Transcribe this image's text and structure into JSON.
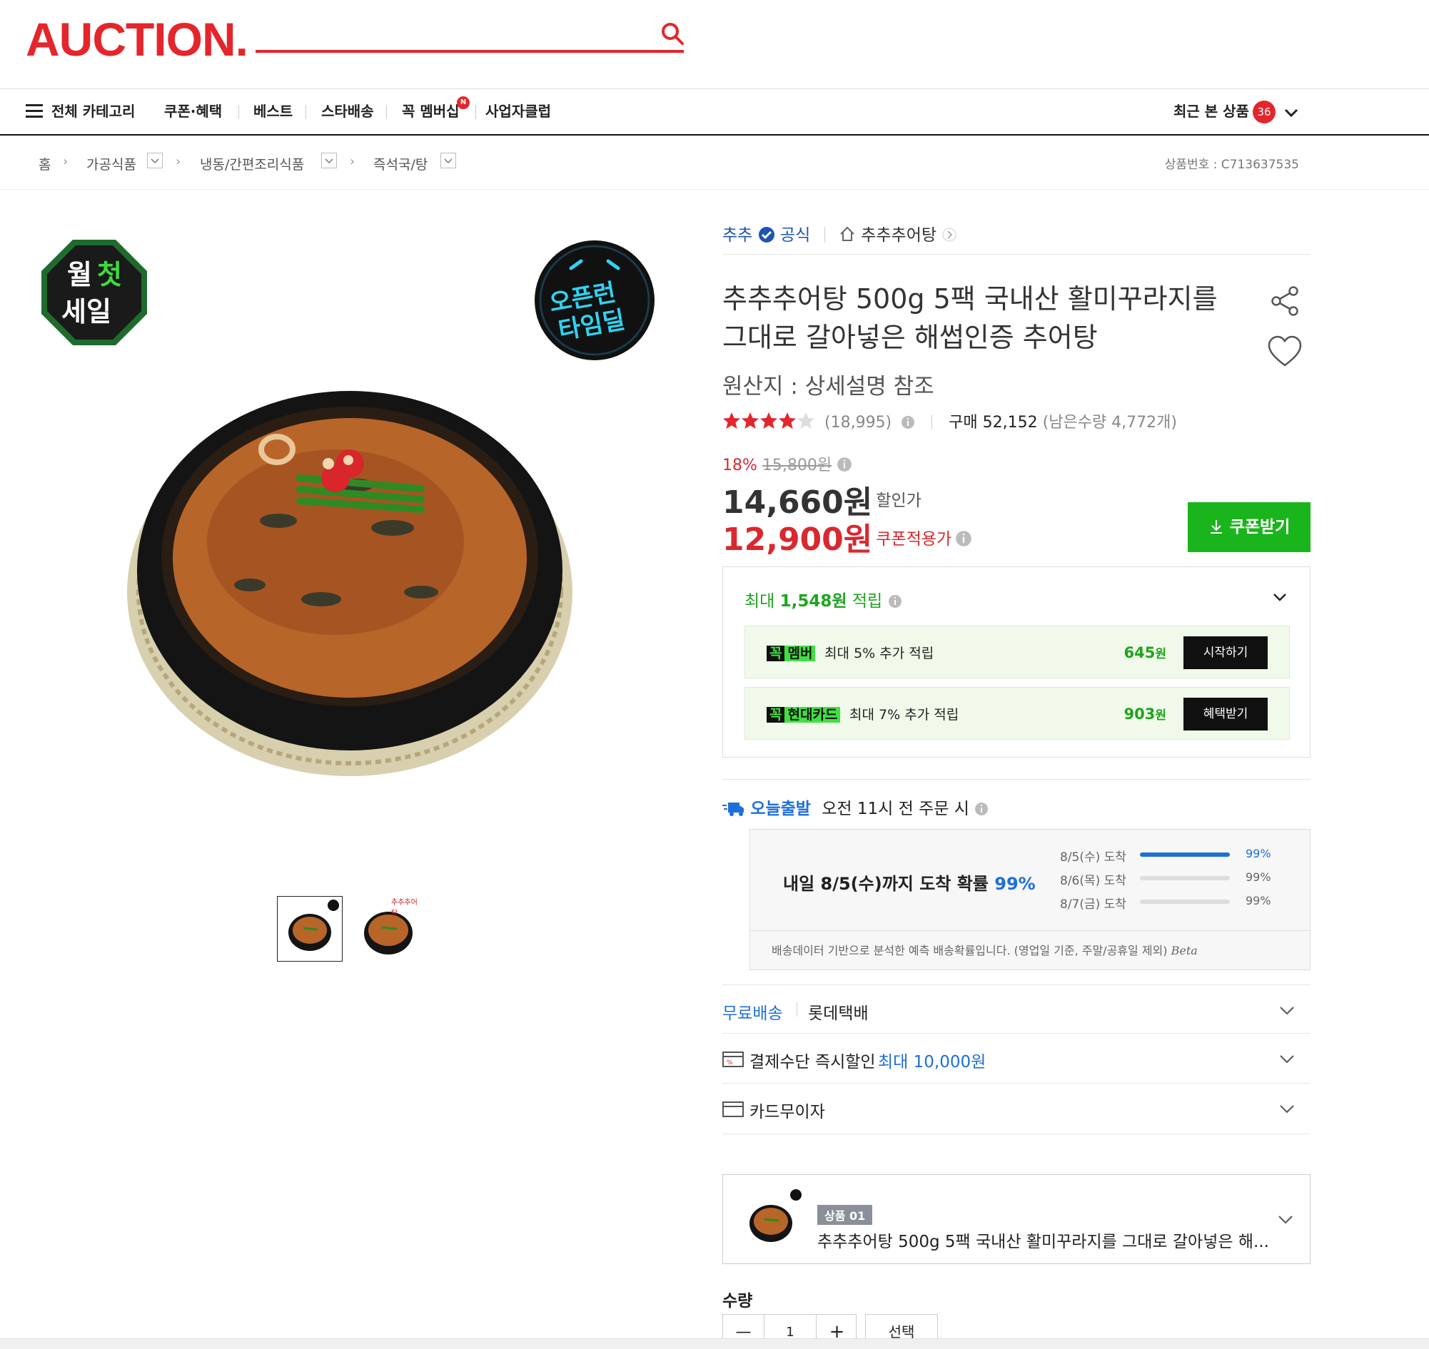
{
  "header": {
    "logo": "AUCTION.",
    "nav": {
      "all_category": "전체 카테고리",
      "items": [
        "쿠폰·혜택",
        "베스트",
        "스타배송",
        "꼭 멤버십",
        "사업자클럽"
      ],
      "new_badge": "N",
      "recent": "최근 본 상품",
      "recent_count": "36"
    }
  },
  "breadcrumb": {
    "home": "홈",
    "items": [
      "가공식품",
      "냉동/간편조리식품",
      "즉석국/탕"
    ],
    "product_no": "상품번호 : C713637535"
  },
  "gallery": {
    "badge_left": [
      "월",
      "첫",
      "세일"
    ],
    "badge_right": [
      "오픈런",
      "타임딜"
    ],
    "thumb2_label": "추추추어탕"
  },
  "product": {
    "seller_brand": "추추",
    "seller_official": "공식",
    "store_name": "추추추어탕",
    "title": "추추추어탕 500g 5팩 국내산 활미꾸라지를 그대로 갈아넣은 해썹인증 추어탕",
    "origin": "원산지 : 상세설명 참조",
    "rating": 4.5,
    "review_count": "(18,995)",
    "purchase_label": "구매",
    "purchase_count": "52,152",
    "remaining": "(남은수량 4,772개)",
    "discount_rate": "18%",
    "original_price": "15,800원",
    "sale_price": "14,660원",
    "sale_label": "할인가",
    "coupon_price": "12,900원",
    "coupon_label": "쿠폰적용가",
    "coupon_button": "쿠폰받기"
  },
  "reward": {
    "prefix": "최대",
    "amount": "1,548원",
    "suffix": "적립",
    "rows": [
      {
        "tag_a": "꼭",
        "tag_b": "멤버",
        "text": "최대 5% 추가 적립",
        "amount": "645",
        "unit": "원",
        "button": "시작하기"
      },
      {
        "tag_a": "꼭",
        "tag_b": "현대카드",
        "text": "최대 7% 추가 적립",
        "amount": "903",
        "unit": "원",
        "button": "혜택받기"
      }
    ]
  },
  "shipping": {
    "label": "오늘출발",
    "cutoff": "오전 11시 전 주문 시",
    "headline": "내일 8/5(수)까지 도착 확률",
    "headline_pct": "99%",
    "rows": [
      {
        "date": "8/5(수) 도착",
        "pct_label": "99%",
        "fill": 1.0
      },
      {
        "date": "8/6(목) 도착",
        "pct_label": "99%",
        "fill": 0.0
      },
      {
        "date": "8/7(금) 도착",
        "pct_label": "99%",
        "fill": 0.0
      }
    ],
    "note": "배송데이터 기반으로 분석한 예측 배송확률입니다. (영업일 기준, 주말/공휴일 제외)",
    "beta": "Beta"
  },
  "options": {
    "free_shipping": "무료배송",
    "courier": "롯데택배",
    "payment_label": "결제수단 즉시할인",
    "payment_value": "최대 10,000원",
    "installment": "카드무이자"
  },
  "selected": {
    "tag": "상품 01",
    "title": "추추추어탕 500g 5팩 국내산 활미꾸라지를 그대로 갈아넣은 해..."
  },
  "quantity": {
    "label": "수량",
    "value": "1",
    "minus": "—",
    "plus": "+",
    "select_button": "선택"
  },
  "colors": {
    "brand_red": "#e4262c",
    "green": "#1ab51c",
    "blue": "#1e6fd9",
    "price_red": "#d9282f"
  }
}
